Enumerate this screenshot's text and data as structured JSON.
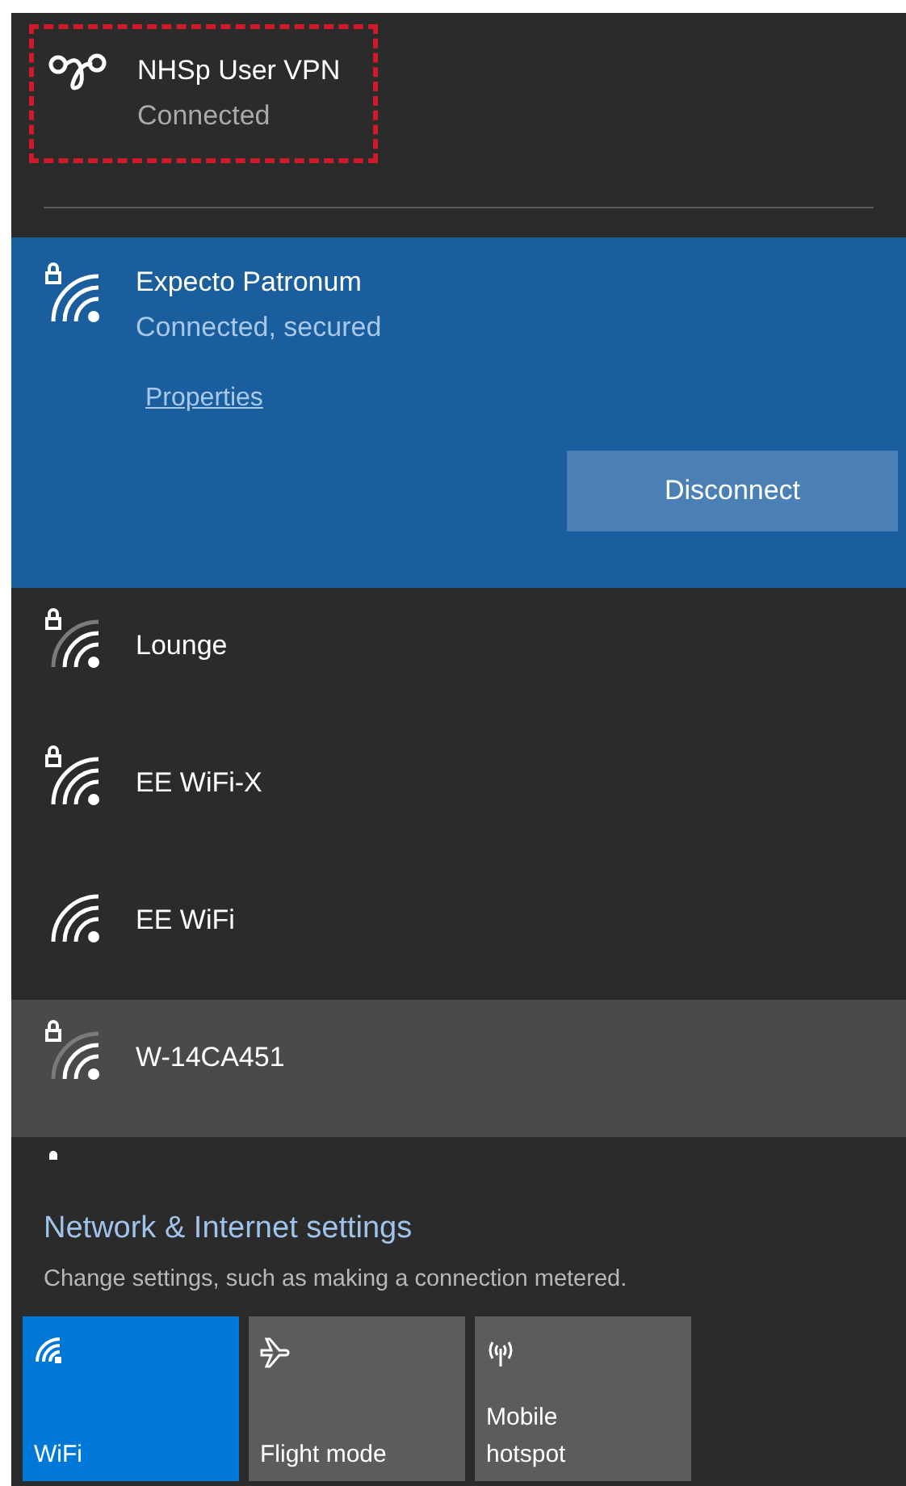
{
  "vpn": {
    "name": "NHSp User VPN",
    "status": "Connected",
    "highlighted": true
  },
  "connected_network": {
    "name": "Expecto Patronum",
    "status": "Connected, secured",
    "secured": true,
    "link": "Properties",
    "button": "Disconnect"
  },
  "networks": [
    {
      "name": "Lounge",
      "secured": true,
      "weak_signal": true,
      "hovered": false
    },
    {
      "name": "EE WiFi-X",
      "secured": true,
      "weak_signal": false,
      "hovered": false
    },
    {
      "name": "EE WiFi",
      "secured": false,
      "weak_signal": false,
      "hovered": false
    },
    {
      "name": "W-14CA451",
      "secured": true,
      "weak_signal": true,
      "hovered": true
    }
  ],
  "next_network_peek": {
    "secured": true
  },
  "settings": {
    "link": "Network & Internet settings",
    "description": "Change settings, such as making a connection metered."
  },
  "tiles": [
    {
      "kind": "wifi",
      "label": "WiFi",
      "on": true
    },
    {
      "kind": "plane",
      "label": "Flight mode",
      "on": false
    },
    {
      "kind": "antenna",
      "label": "Mobile hotspot",
      "on": false
    }
  ]
}
